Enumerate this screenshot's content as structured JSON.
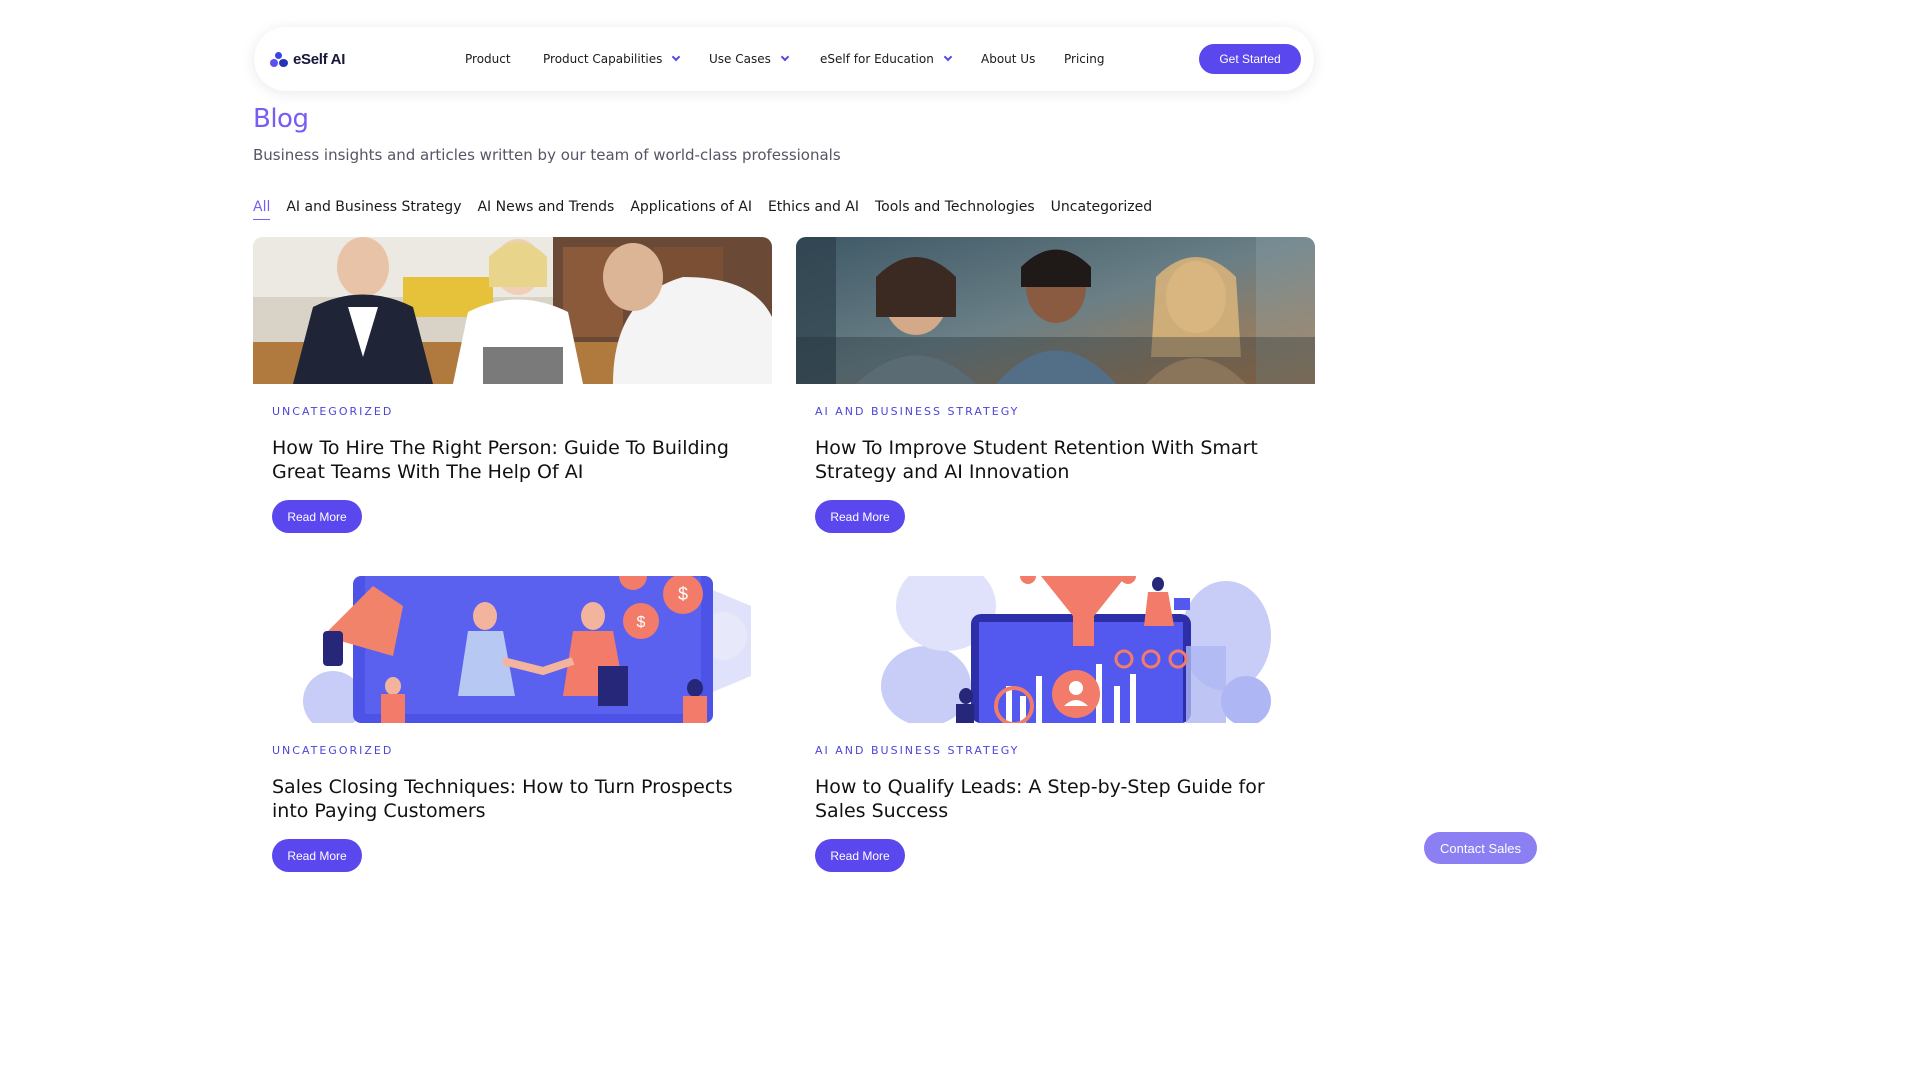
{
  "brand": {
    "name": "eSelf AI"
  },
  "nav": {
    "items": [
      {
        "label": "Product"
      },
      {
        "label": "Product Capabilities"
      },
      {
        "label": "Use Cases"
      },
      {
        "label": "eSelf for Education"
      },
      {
        "label": "About Us"
      },
      {
        "label": "Pricing"
      }
    ],
    "cta": "Get Started"
  },
  "page": {
    "title": "Blog",
    "subtitle": "Business insights and articles written by our team of world-class professionals"
  },
  "filters": [
    {
      "label": "All",
      "active": true
    },
    {
      "label": "AI and Business Strategy"
    },
    {
      "label": "AI News and Trends"
    },
    {
      "label": "Applications of AI"
    },
    {
      "label": "Ethics and AI"
    },
    {
      "label": "Tools and Technologies"
    },
    {
      "label": "Uncategorized"
    }
  ],
  "posts": [
    {
      "category": "UNCATEGORIZED",
      "title": "How To Hire The Right Person: Guide To Building Great Teams With The Help Of AI",
      "cta": "Read More",
      "image": "business-meeting-photo"
    },
    {
      "category": "AI AND BUSINESS STRATEGY",
      "title": "How To Improve Student Retention With Smart Strategy and AI Innovation",
      "cta": "Read More",
      "image": "students-studying-photo"
    },
    {
      "category": "UNCATEGORIZED",
      "title": "Sales Closing Techniques: How to Turn Prospects into Paying Customers",
      "cta": "Read More",
      "image": "handshake-deal-illustration"
    },
    {
      "category": "AI AND BUSINESS STRATEGY",
      "title": "How to Qualify Leads: A Step-by-Step Guide for Sales Success",
      "cta": "Read More",
      "image": "sales-funnel-illustration"
    }
  ],
  "contact": {
    "label": "Contact Sales"
  },
  "colors": {
    "accent": "#5b47ee",
    "title": "#7a5cf0",
    "category": "#4c45d8",
    "contact": "#8b7ff3"
  }
}
